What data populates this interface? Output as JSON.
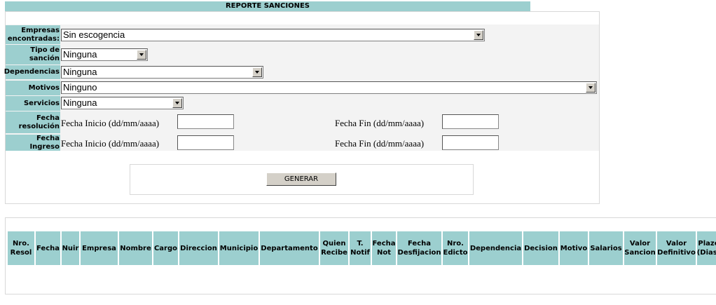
{
  "title": "REPORTE SANCIONES",
  "form": {
    "empresas": {
      "label_l1": "Empresas",
      "label_l2": "encontradas:",
      "value": "Sin escogencia"
    },
    "tipo": {
      "label_l1": "Tipo de",
      "label_l2": "sanción",
      "value": "Ninguna"
    },
    "dependencias": {
      "label": "Dependencias",
      "value": "Ninguna"
    },
    "motivos": {
      "label": "Motivos",
      "value": "Ninguno"
    },
    "servicios": {
      "label": "Servicios",
      "value": "Ninguna"
    },
    "fecha_resolucion": {
      "label_l1": "Fecha",
      "label_l2": "resolución",
      "inicio_label": "Fecha Inicio (dd/mm/aaaa)",
      "fin_label": "Fecha Fin (dd/mm/aaaa)",
      "inicio_value": "",
      "fin_value": ""
    },
    "fecha_ingreso": {
      "label": "Fecha Ingreso",
      "inicio_label": "Fecha Inicio (dd/mm/aaaa)",
      "fin_label": "Fecha Fin (dd/mm/aaaa)",
      "inicio_value": "",
      "fin_value": ""
    }
  },
  "button": {
    "generar": "GENERAR"
  },
  "table": {
    "columns": [
      [
        "Nro.",
        "Resol"
      ],
      [
        "Fecha"
      ],
      [
        "Nuir"
      ],
      [
        "Empresa"
      ],
      [
        "Nombre"
      ],
      [
        "Cargo"
      ],
      [
        "Direccion"
      ],
      [
        "Municipio"
      ],
      [
        "Departamento"
      ],
      [
        "Quien",
        "Recibe"
      ],
      [
        "T.",
        "Notif"
      ],
      [
        "Fecha",
        "Not"
      ],
      [
        "Fecha",
        "Desfijacion"
      ],
      [
        "Nro.",
        "Edicto"
      ],
      [
        "Dependencia"
      ],
      [
        "Decision"
      ],
      [
        "Motivo"
      ],
      [
        "Salarios"
      ],
      [
        "Valor",
        "Sancion"
      ],
      [
        "Valor",
        "Definitivo"
      ],
      [
        "Plazo",
        "(Dias)"
      ]
    ]
  },
  "colors": {
    "header_bg": "#9ccfcf",
    "form_bg": "#f3f3f3",
    "button_bg": "#d4d0c8"
  }
}
